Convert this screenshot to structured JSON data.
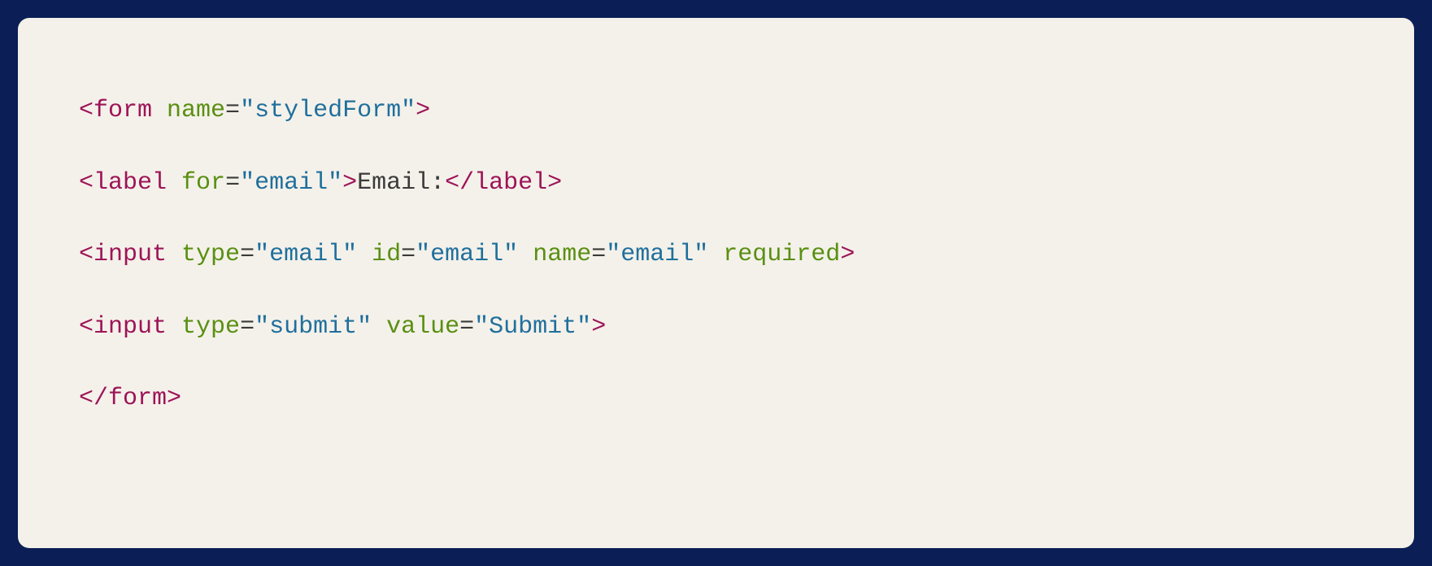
{
  "code": {
    "lines": [
      {
        "tokens": [
          {
            "cls": "tag",
            "t": "<form"
          },
          {
            "cls": "text",
            "t": " "
          },
          {
            "cls": "attr",
            "t": "name"
          },
          {
            "cls": "eq",
            "t": "="
          },
          {
            "cls": "val",
            "t": "\"styledForm\""
          },
          {
            "cls": "tag",
            "t": ">"
          }
        ]
      },
      {
        "tokens": [
          {
            "cls": "tag",
            "t": "<label"
          },
          {
            "cls": "text",
            "t": " "
          },
          {
            "cls": "attr",
            "t": "for"
          },
          {
            "cls": "eq",
            "t": "="
          },
          {
            "cls": "val",
            "t": "\"email\""
          },
          {
            "cls": "tag",
            "t": ">"
          },
          {
            "cls": "text",
            "t": "Email:"
          },
          {
            "cls": "tag",
            "t": "</label>"
          }
        ]
      },
      {
        "tokens": [
          {
            "cls": "tag",
            "t": "<input"
          },
          {
            "cls": "text",
            "t": " "
          },
          {
            "cls": "attr",
            "t": "type"
          },
          {
            "cls": "eq",
            "t": "="
          },
          {
            "cls": "val",
            "t": "\"email\""
          },
          {
            "cls": "text",
            "t": " "
          },
          {
            "cls": "attr",
            "t": "id"
          },
          {
            "cls": "eq",
            "t": "="
          },
          {
            "cls": "val",
            "t": "\"email\""
          },
          {
            "cls": "text",
            "t": " "
          },
          {
            "cls": "attr",
            "t": "name"
          },
          {
            "cls": "eq",
            "t": "="
          },
          {
            "cls": "val",
            "t": "\"email\""
          },
          {
            "cls": "text",
            "t": " "
          },
          {
            "cls": "attr",
            "t": "required"
          },
          {
            "cls": "tag",
            "t": ">"
          }
        ]
      },
      {
        "tokens": [
          {
            "cls": "tag",
            "t": "<input"
          },
          {
            "cls": "text",
            "t": " "
          },
          {
            "cls": "attr",
            "t": "type"
          },
          {
            "cls": "eq",
            "t": "="
          },
          {
            "cls": "val",
            "t": "\"submit\""
          },
          {
            "cls": "text",
            "t": " "
          },
          {
            "cls": "attr",
            "t": "value"
          },
          {
            "cls": "eq",
            "t": "="
          },
          {
            "cls": "val",
            "t": "\"Submit\""
          },
          {
            "cls": "tag",
            "t": ">"
          }
        ]
      },
      {
        "tokens": [
          {
            "cls": "tag",
            "t": "</form>"
          }
        ]
      }
    ]
  }
}
